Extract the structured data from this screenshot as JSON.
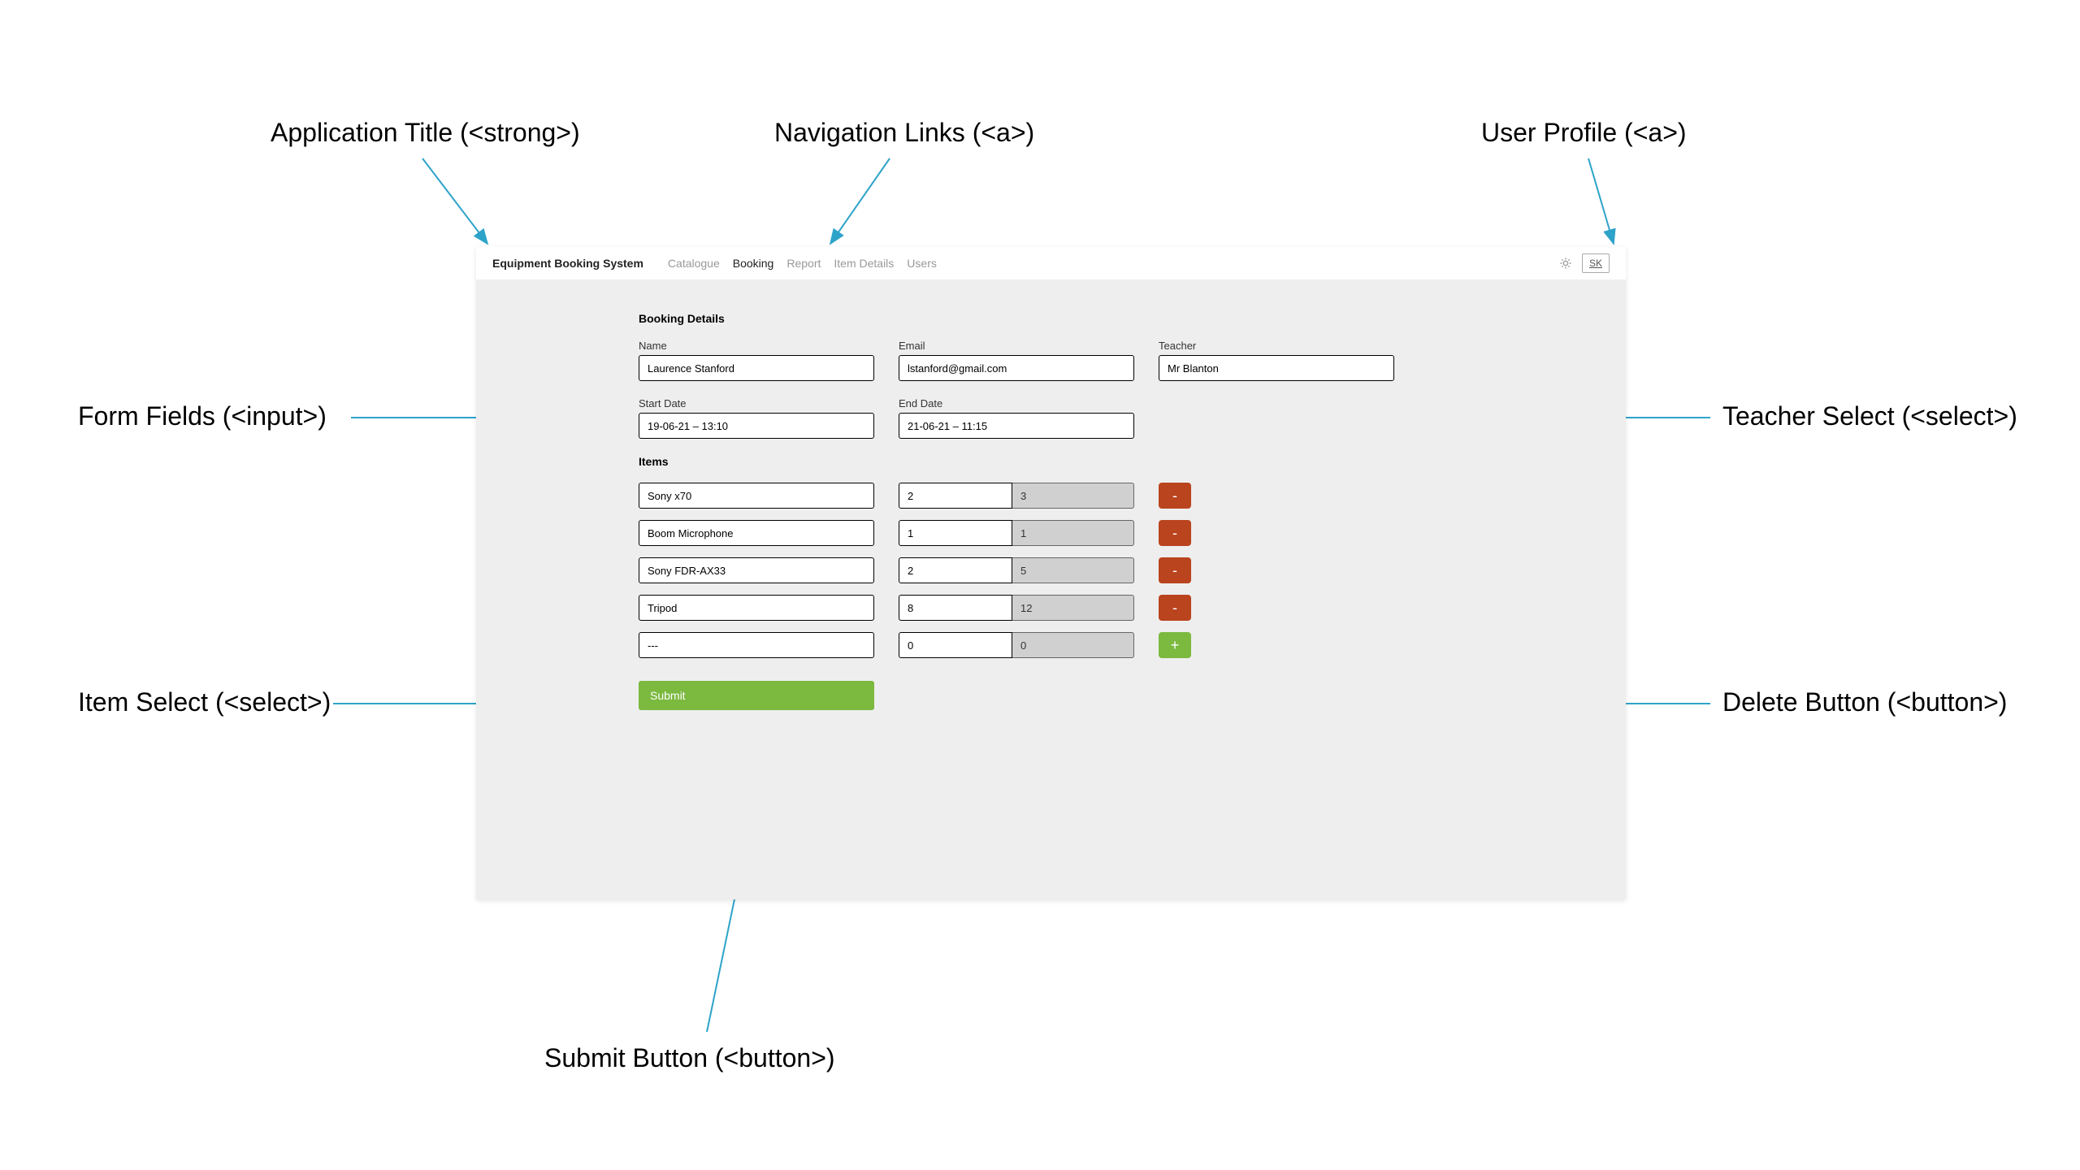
{
  "annotations": {
    "app_title": "Application Title (<strong>)",
    "nav_links": "Navigation Links (<a>)",
    "user_profile": "User Profile (<a>)",
    "form_fields": "Form Fields (<input>)",
    "teacher_select": "Teacher Select (<select>)",
    "item_select": "Item Select (<select>)",
    "delete_button": "Delete Button (<button>)",
    "submit_button": "Submit Button (<button>)"
  },
  "header": {
    "title": "Equipment Booking System",
    "nav": [
      {
        "label": "Catalogue",
        "active": false
      },
      {
        "label": "Booking",
        "active": true
      },
      {
        "label": "Report",
        "active": false
      },
      {
        "label": "Item Details",
        "active": false
      },
      {
        "label": "Users",
        "active": false
      }
    ],
    "profile_initials": "SK"
  },
  "form": {
    "heading": "Booking Details",
    "name_label": "Name",
    "name_value": "Laurence Stanford",
    "email_label": "Email",
    "email_value": "lstanford@gmail.com",
    "teacher_label": "Teacher",
    "teacher_value": "Mr Blanton",
    "start_label": "Start Date",
    "start_value": "19-06-21 – 13:10",
    "end_label": "End Date",
    "end_value": "21-06-21 – 11:15",
    "items_heading": "Items",
    "items": [
      {
        "name": "Sony x70",
        "qty": "2",
        "avail": "3",
        "action": "delete"
      },
      {
        "name": "Boom Microphone",
        "qty": "1",
        "avail": "1",
        "action": "delete"
      },
      {
        "name": "Sony FDR-AX33",
        "qty": "2",
        "avail": "5",
        "action": "delete"
      },
      {
        "name": "Tripod",
        "qty": "8",
        "avail": "12",
        "action": "delete"
      },
      {
        "name": "---",
        "qty": "0",
        "avail": "0",
        "action": "add"
      }
    ],
    "submit_label": "Submit"
  }
}
